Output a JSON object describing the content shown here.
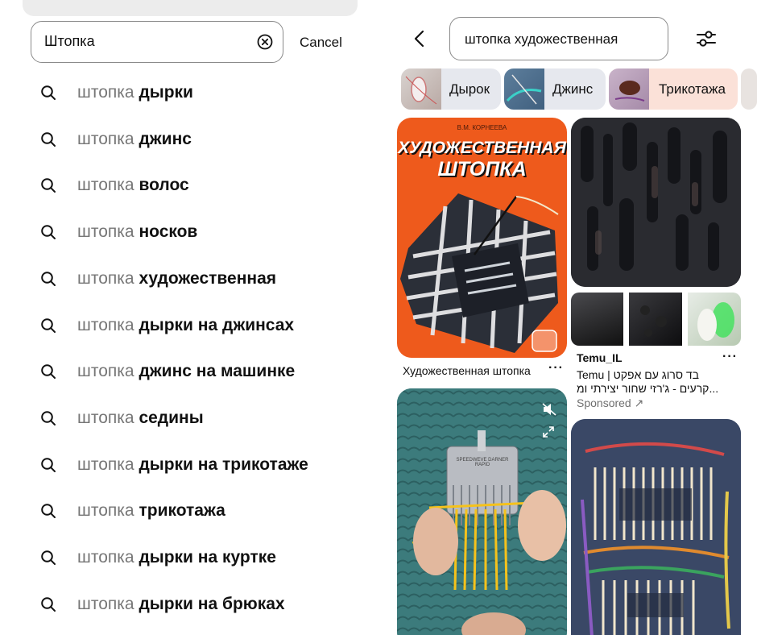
{
  "left": {
    "search": {
      "value": "Штопка"
    },
    "cancel_label": "Cancel",
    "suggestions": [
      {
        "prefix": "штопка ",
        "bold": "дырки"
      },
      {
        "prefix": "штопка ",
        "bold": "джинс"
      },
      {
        "prefix": "штопка ",
        "bold": "волос"
      },
      {
        "prefix": "штопка ",
        "bold": "носков"
      },
      {
        "prefix": "штопка ",
        "bold": "художественная"
      },
      {
        "prefix": "штопка ",
        "bold": "дырки на джинсах"
      },
      {
        "prefix": "штопка ",
        "bold": "джинс на машинке"
      },
      {
        "prefix": "штопка ",
        "bold": "седины"
      },
      {
        "prefix": "штопка ",
        "bold": "дырки на трикотаже"
      },
      {
        "prefix": "штопка ",
        "bold": "трикотажа"
      },
      {
        "prefix": "штопка ",
        "bold": "дырки на куртке"
      },
      {
        "prefix": "штопка ",
        "bold": "дырки на брюках"
      }
    ]
  },
  "right": {
    "search_query": "штопка художественная",
    "chips": [
      {
        "label": "Дырок",
        "color": "#e6e8ee"
      },
      {
        "label": "Джинс",
        "color": "#e6e8ee"
      },
      {
        "label": "Трикотажа",
        "color": "#fbe1d8"
      }
    ],
    "pins": {
      "book": {
        "author": "В.М. КОРНЕЕВА",
        "title_line1": "ХУДОЖЕСТВЕННАЯ",
        "title_line2": "ШТОПКА",
        "caption": "Художественная штопка",
        "menu": "···"
      },
      "ad": {
        "advertiser": "Temu_IL",
        "menu": "···",
        "line1": "Temu | בד סרוג עם אפקט",
        "line2": "קרעים - ג'רזי שחור יצירתי ומ...",
        "sponsored": "Sponsored ↗"
      },
      "video": {
        "tool_text": "SPEEDWEVE DARNER RAPID"
      }
    },
    "colors": {
      "book_orange": "#ee5a1c",
      "teal_knit": "#3f7f7f",
      "yellow_thread": "#f5c21b"
    }
  }
}
